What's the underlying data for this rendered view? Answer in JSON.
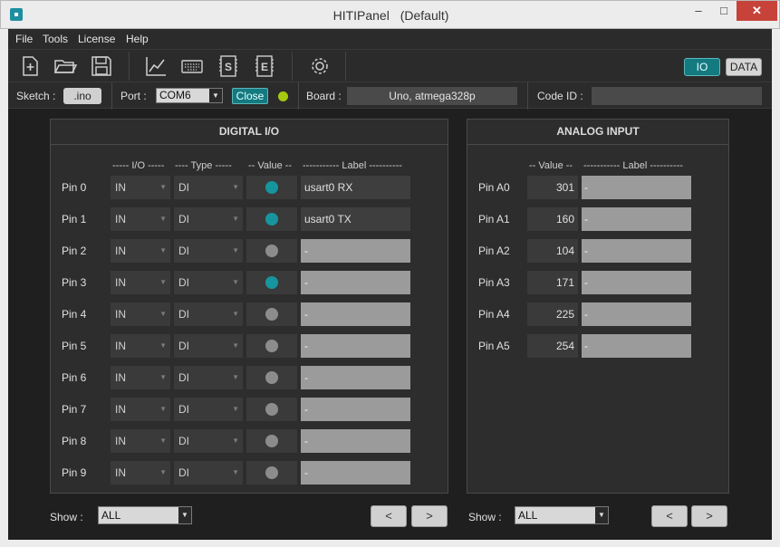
{
  "window": {
    "app_name": "HITIPanel",
    "profile": "(Default)"
  },
  "menu": [
    "File",
    "Tools",
    "License",
    "Help"
  ],
  "toolbar": {
    "icons": [
      "new-file-icon",
      "open-folder-icon",
      "save-icon",
      "chart-icon",
      "keyboard-icon",
      "script-s-icon",
      "script-e-icon",
      "settings-gear-icon"
    ],
    "io_label": "IO",
    "data_label": "DATA"
  },
  "infobar": {
    "sketch_label": "Sketch :",
    "sketch_button": ".ino",
    "port_label": "Port :",
    "port_value": "COM6",
    "close_button": "Close",
    "status_color": "#a6c90f",
    "board_label": "Board :",
    "board_value": "Uno, atmega328p",
    "code_id_label": "Code ID :",
    "code_id_value": ""
  },
  "digital": {
    "title": "DIGITAL  I/O",
    "headers": {
      "io": "----- I/O -----",
      "type": "---- Type -----",
      "value": "-- Value --",
      "label": "----------- Label ----------"
    },
    "pins": [
      {
        "name": "Pin 0",
        "io": "IN",
        "type": "DI",
        "on": true,
        "label": "usart0 RX"
      },
      {
        "name": "Pin 1",
        "io": "IN",
        "type": "DI",
        "on": true,
        "label": "usart0 TX"
      },
      {
        "name": "Pin 2",
        "io": "IN",
        "type": "DI",
        "on": false,
        "label": "-"
      },
      {
        "name": "Pin 3",
        "io": "IN",
        "type": "DI",
        "on": true,
        "label": "-"
      },
      {
        "name": "Pin 4",
        "io": "IN",
        "type": "DI",
        "on": false,
        "label": "-"
      },
      {
        "name": "Pin 5",
        "io": "IN",
        "type": "DI",
        "on": false,
        "label": "-"
      },
      {
        "name": "Pin 6",
        "io": "IN",
        "type": "DI",
        "on": false,
        "label": "-"
      },
      {
        "name": "Pin 7",
        "io": "IN",
        "type": "DI",
        "on": false,
        "label": "-"
      },
      {
        "name": "Pin 8",
        "io": "IN",
        "type": "DI",
        "on": false,
        "label": "-"
      },
      {
        "name": "Pin 9",
        "io": "IN",
        "type": "DI",
        "on": false,
        "label": "-"
      }
    ],
    "show_label": "Show :",
    "show_value": "ALL",
    "prev": "<",
    "next": ">"
  },
  "analog": {
    "title": "ANALOG  INPUT",
    "headers": {
      "value": "-- Value --",
      "label": "----------- Label ----------"
    },
    "pins": [
      {
        "name": "Pin A0",
        "value": "301",
        "label": "-"
      },
      {
        "name": "Pin A1",
        "value": "160",
        "label": "-"
      },
      {
        "name": "Pin A2",
        "value": "104",
        "label": "-"
      },
      {
        "name": "Pin A3",
        "value": "171",
        "label": "-"
      },
      {
        "name": "Pin A4",
        "value": "225",
        "label": "-"
      },
      {
        "name": "Pin A5",
        "value": "254",
        "label": "-"
      }
    ],
    "show_label": "Show :",
    "show_value": "ALL",
    "prev": "<",
    "next": ">"
  },
  "colors": {
    "led_on": "#17959e",
    "led_off": "#8c8c8c",
    "accent": "#137a80"
  }
}
